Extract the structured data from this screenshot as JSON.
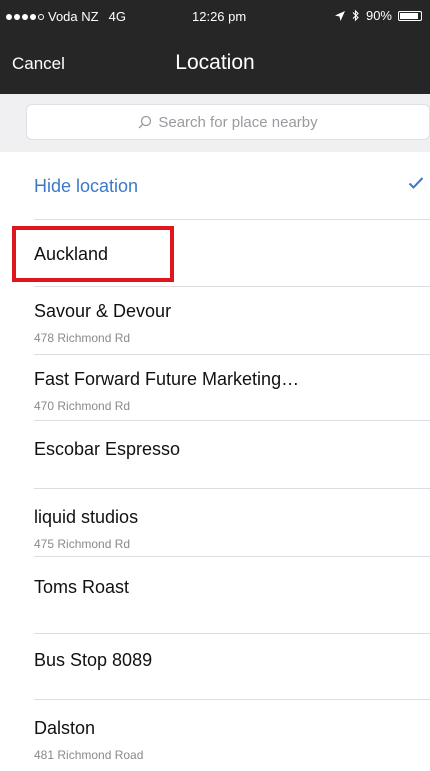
{
  "status_bar": {
    "carrier": "Voda NZ",
    "network": "4G",
    "time": "12:26 pm",
    "battery_percent": "90%",
    "battery_level": 0.9,
    "location_icon": "location-arrow-icon",
    "bluetooth_icon": "bluetooth-icon"
  },
  "nav": {
    "cancel_label": "Cancel",
    "title": "Location"
  },
  "search": {
    "placeholder": "Search for place nearby",
    "icon": "search-icon"
  },
  "hide_location": {
    "label": "Hide location",
    "selected": true,
    "accent_color": "#3d79c9"
  },
  "places": [
    {
      "name": "Auckland",
      "address": ""
    },
    {
      "name": "Savour & Devour",
      "address": "478 Richmond Rd"
    },
    {
      "name": "Fast Forward Future Marketing…",
      "address": "470 Richmond Rd"
    },
    {
      "name": "Escobar Espresso",
      "address": ""
    },
    {
      "name": "liquid studios",
      "address": "475 Richmond Rd"
    },
    {
      "name": "Toms Roast",
      "address": ""
    },
    {
      "name": "Bus Stop 8089",
      "address": ""
    },
    {
      "name": "Dalston",
      "address": "481 Richmond Road"
    }
  ],
  "highlight": {
    "target": "Auckland",
    "color": "#e0161f"
  }
}
